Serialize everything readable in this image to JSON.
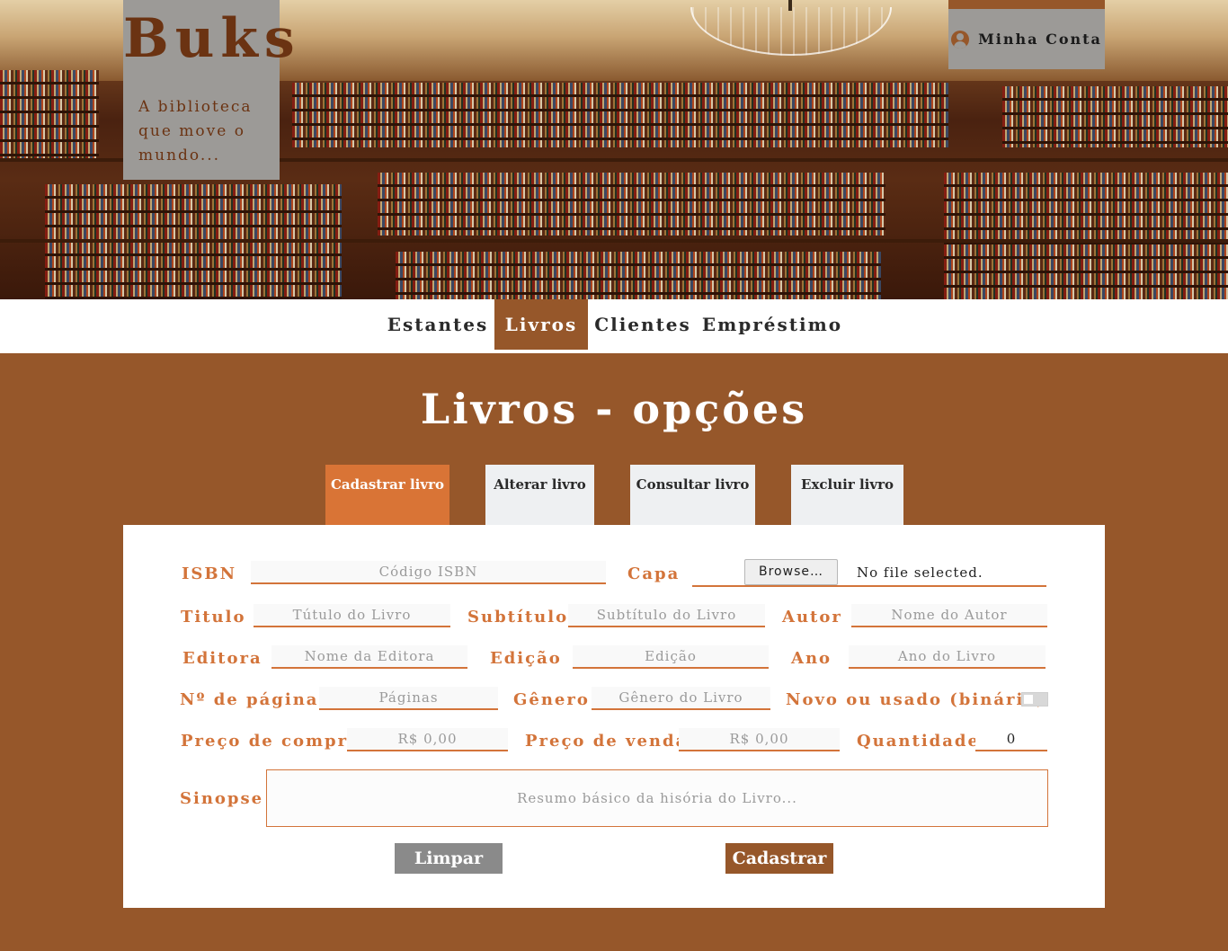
{
  "brand": {
    "name": "Buks",
    "tagline": "A biblioteca que move o mundo..."
  },
  "account": {
    "label": "Minha Conta",
    "icon": "user-circle-icon"
  },
  "nav": {
    "items": [
      "Estantes",
      "Livros",
      "Clientes",
      "Empréstimo"
    ],
    "active": "Livros"
  },
  "page": {
    "title": "Livros - opções"
  },
  "tabs": {
    "items": [
      "Cadastrar livro",
      "Alterar livro",
      "Consultar livro",
      "Excluir livro"
    ],
    "active": "Cadastrar livro"
  },
  "form": {
    "isbn": {
      "label": "ISBN",
      "placeholder": "Código ISBN"
    },
    "capa": {
      "label": "Capa",
      "button": "Browse…",
      "status": "No file selected."
    },
    "titulo": {
      "label": "Titulo",
      "placeholder": "Tútulo do Livro"
    },
    "subtitulo": {
      "label": "Subtítulo",
      "placeholder": "Subtítulo do Livro"
    },
    "autor": {
      "label": "Autor",
      "placeholder": "Nome do Autor"
    },
    "editora": {
      "label": "Editora",
      "placeholder": "Nome da Editora"
    },
    "edicao": {
      "label": "Edição",
      "placeholder": "Edição"
    },
    "ano": {
      "label": "Ano",
      "placeholder": "Ano do Livro"
    },
    "paginas": {
      "label": "Nº de páginas",
      "placeholder": "Páginas"
    },
    "genero": {
      "label": "Gênero",
      "placeholder": "Gênero do Livro"
    },
    "novo_usado": {
      "label": "Novo ou usado (binário)",
      "checked": false
    },
    "preco_compra": {
      "label": "Preço de compra",
      "placeholder": "R$ 0,00"
    },
    "preco_venda": {
      "label": "Preço de venda",
      "placeholder": "R$ 0,00"
    },
    "quantidade": {
      "label": "Quantidade",
      "value": "0"
    },
    "sinopse": {
      "label": "Sinopse",
      "placeholder": "Resumo básico da hisória do Livro..."
    }
  },
  "buttons": {
    "clear": "Limpar",
    "submit": "Cadastrar"
  },
  "colors": {
    "brand_brown": "#96572a",
    "accent_orange": "#d3743a",
    "active_tab": "#d97436",
    "gray_box": "#9c9a97"
  }
}
